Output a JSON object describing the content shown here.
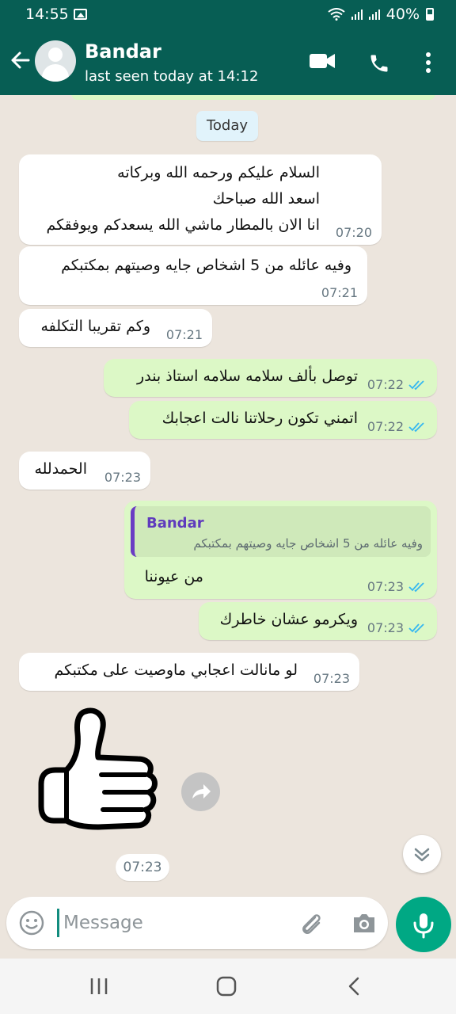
{
  "status_bar": {
    "time": "14:55",
    "battery": "40%"
  },
  "header": {
    "name": "Bandar",
    "last_seen": "last seen today at 14:12"
  },
  "date_chip": "Today",
  "messages": [
    {
      "dir": "in",
      "lines": [
        "السلام عليكم ورحمه الله وبركاته",
        "اسعد الله صباحك",
        "انا الان بالمطار ماشي الله يسعدكم ويوفقكم"
      ],
      "time": "07:20"
    },
    {
      "dir": "in",
      "text": "وفيه عائله من 5 اشخاص جايه وصيتهم بمكتبكم",
      "time": "07:21"
    },
    {
      "dir": "in",
      "text": "وكم تقريبا التكلفه",
      "time": "07:21"
    },
    {
      "dir": "out",
      "text": "توصل بألف سلامه سلامه استاذ بندر",
      "time": "07:22",
      "status": "read"
    },
    {
      "dir": "out",
      "text": "اتمني تكون رحلاتنا نالت اعجابك",
      "time": "07:22",
      "status": "read"
    },
    {
      "dir": "in",
      "text": "الحمدلله",
      "time": "07:23"
    },
    {
      "dir": "out",
      "reply": {
        "name": "Bandar",
        "text": "وفيه عائله من 5 اشخاص جايه وصيتهم بمكتبكم"
      },
      "text": "من عيوننا",
      "time": "07:23",
      "status": "read"
    },
    {
      "dir": "out",
      "text": "ويكرمو عشان خاطرك",
      "time": "07:23",
      "status": "read"
    },
    {
      "dir": "in",
      "text": "لو مانالت اعجابي ماوصيت على مكتبكم",
      "time": "07:23"
    },
    {
      "dir": "in",
      "type": "sticker",
      "sticker": "thumbs-up",
      "time": "07:23"
    }
  ],
  "composer": {
    "placeholder": "Message",
    "value": ""
  },
  "colors": {
    "header": "#075e54",
    "outgoing_bubble": "#dcf8c6",
    "incoming_bubble": "#ffffff",
    "read_ticks": "#34b7f1",
    "mic_button": "#00a884"
  },
  "icons": [
    "back-arrow-icon",
    "avatar-icon",
    "video-call-icon",
    "voice-call-icon",
    "more-options-icon",
    "double-tick-icon",
    "forward-icon",
    "chevron-down-icon",
    "emoji-icon",
    "paperclip-icon",
    "camera-icon",
    "mic-icon",
    "recents-icon",
    "home-icon",
    "back-nav-icon"
  ]
}
